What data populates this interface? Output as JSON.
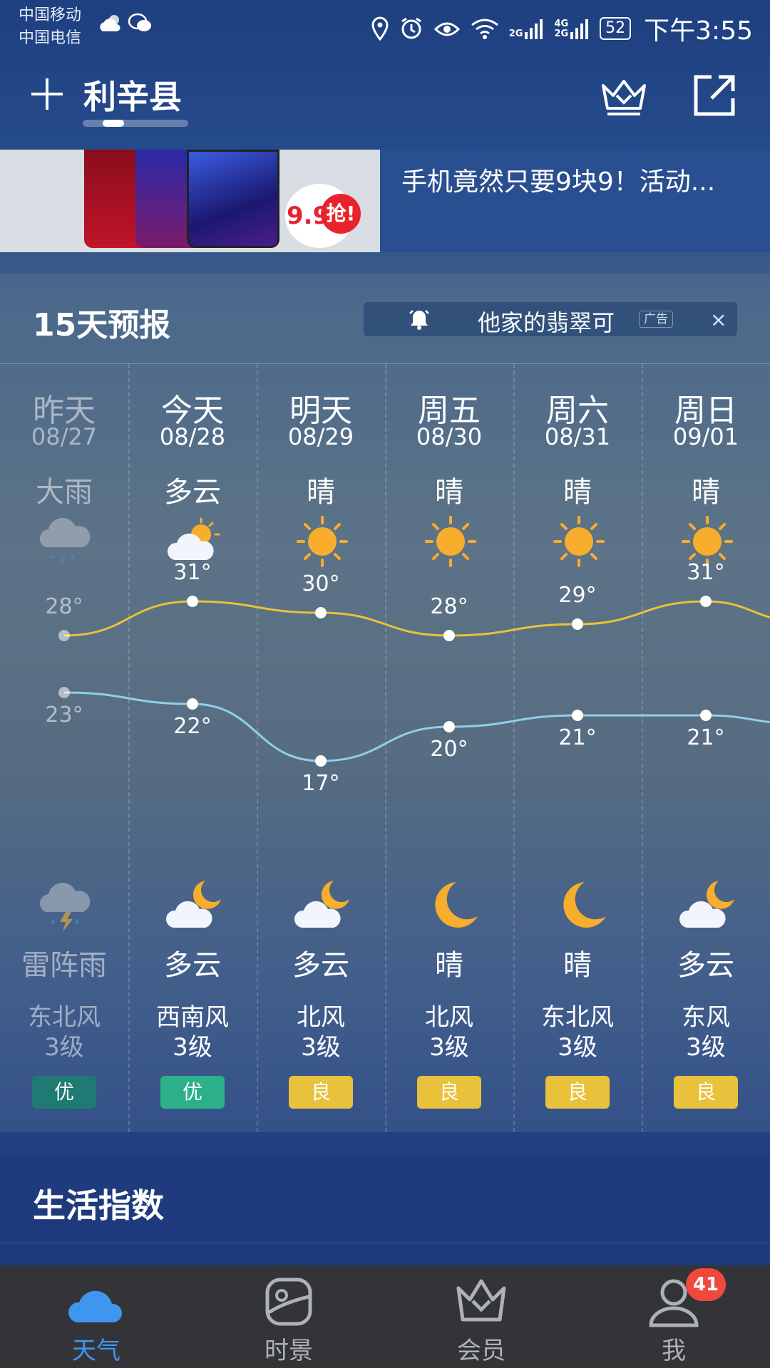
{
  "status_bar": {
    "carrier1": "中国移动",
    "carrier2": "中国电信",
    "net1": "2G",
    "net2": "4G",
    "net3": "2G",
    "battery": "52",
    "time": "下午3:55"
  },
  "header": {
    "city": "利辛县"
  },
  "ad_banner": {
    "badge_price": "9.9",
    "badge_text": "抢!",
    "text": "手机竟然只要9块9！活动..."
  },
  "forecast": {
    "title": "15天预报",
    "ad_chip": {
      "text": "他家的翡翠可",
      "tag": "广告",
      "close": "×"
    },
    "days": [
      {
        "name": "昨天",
        "date": "08/27",
        "day_weather": "大雨",
        "day_icon": "heavy-rain-icon",
        "high": "28°",
        "low": "23°",
        "night_weather": "雷阵雨",
        "night_icon": "thunderstorm-icon",
        "wind_dir": "东北风",
        "wind_level": "3级",
        "aqi": "优",
        "aqi_color": "#1f7a73",
        "past": true
      },
      {
        "name": "今天",
        "date": "08/28",
        "day_weather": "多云",
        "day_icon": "partly-cloudy-day-icon",
        "high": "31°",
        "low": "22°",
        "night_weather": "多云",
        "night_icon": "partly-cloudy-night-icon",
        "wind_dir": "西南风",
        "wind_level": "3级",
        "aqi": "优",
        "aqi_color": "#2bb08a"
      },
      {
        "name": "明天",
        "date": "08/29",
        "day_weather": "晴",
        "day_icon": "sun-icon",
        "high": "30°",
        "low": "17°",
        "night_weather": "多云",
        "night_icon": "partly-cloudy-night-icon",
        "wind_dir": "北风",
        "wind_level": "3级",
        "aqi": "良",
        "aqi_color": "#e9c23d"
      },
      {
        "name": "周五",
        "date": "08/30",
        "day_weather": "晴",
        "day_icon": "sun-icon",
        "high": "28°",
        "low": "20°",
        "night_weather": "晴",
        "night_icon": "moon-icon",
        "wind_dir": "北风",
        "wind_level": "3级",
        "aqi": "良",
        "aqi_color": "#e9c23d"
      },
      {
        "name": "周六",
        "date": "08/31",
        "day_weather": "晴",
        "day_icon": "sun-icon",
        "high": "29°",
        "low": "21°",
        "night_weather": "晴",
        "night_icon": "moon-icon",
        "wind_dir": "东北风",
        "wind_level": "3级",
        "aqi": "良",
        "aqi_color": "#e9c23d"
      },
      {
        "name": "周日",
        "date": "09/01",
        "day_weather": "晴",
        "day_icon": "sun-icon",
        "high": "31°",
        "low": "21°",
        "night_weather": "多云",
        "night_icon": "partly-cloudy-night-icon",
        "wind_dir": "东风",
        "wind_level": "3级",
        "aqi": "良",
        "aqi_color": "#e9c23d"
      }
    ],
    "high_temps": [
      28,
      31,
      30,
      28,
      29,
      31
    ],
    "low_temps": [
      23,
      22,
      17,
      20,
      21,
      21
    ],
    "high_line_color": "#e8c23a",
    "low_line_color": "#8fd0e6"
  },
  "life_index": {
    "title": "生活指数"
  },
  "bottom_nav": {
    "items": [
      {
        "label": "天气",
        "icon": "cloud-icon",
        "active": true
      },
      {
        "label": "时景",
        "icon": "scenery-icon"
      },
      {
        "label": "会员",
        "icon": "crown-icon"
      },
      {
        "label": "我",
        "icon": "user-icon"
      }
    ],
    "badge": "41",
    "active_color": "#3f96ef"
  }
}
